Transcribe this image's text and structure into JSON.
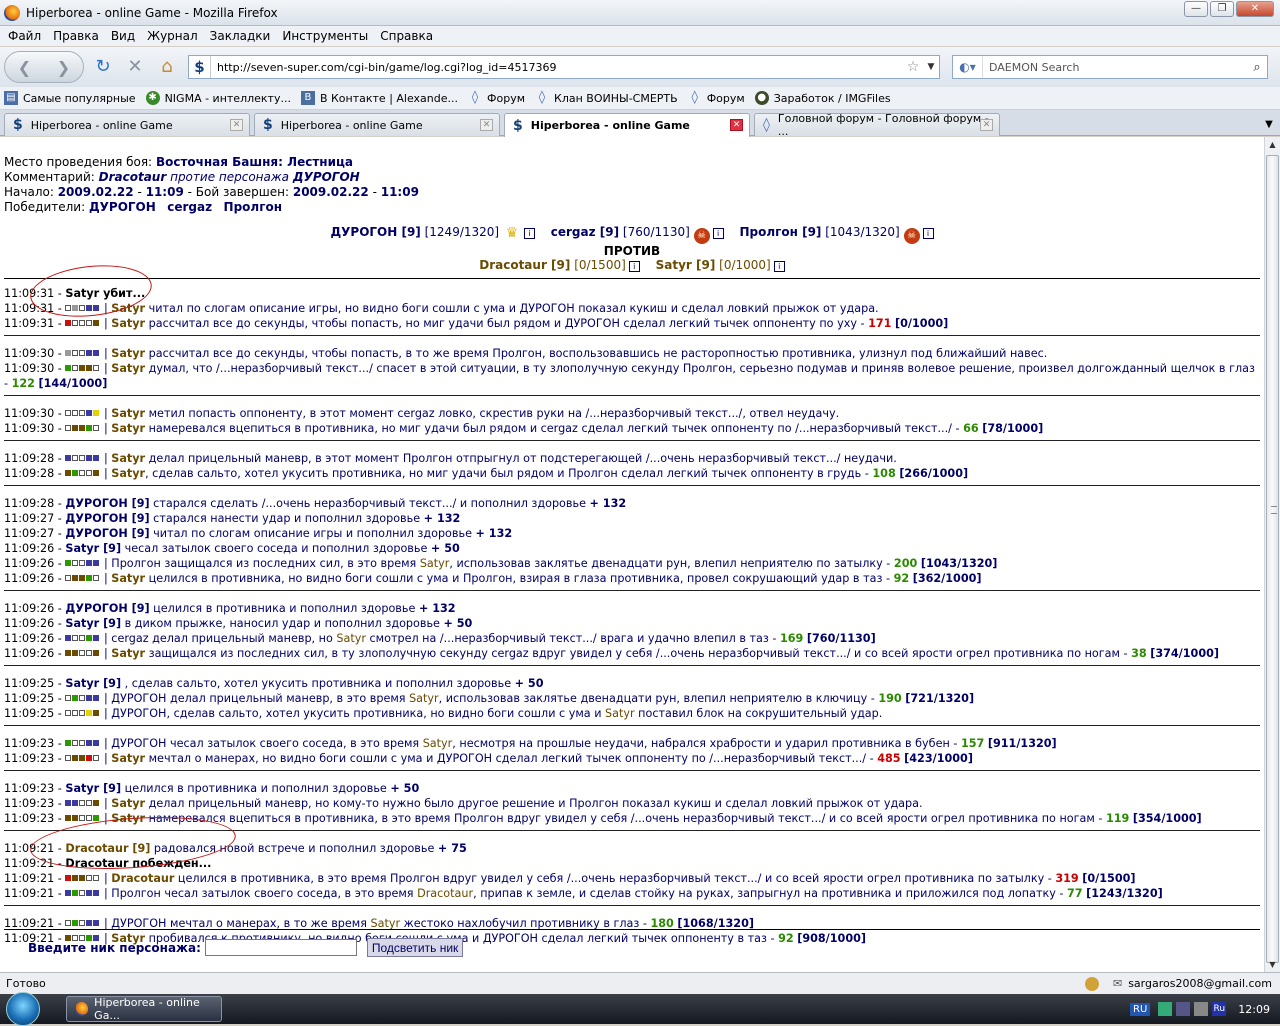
{
  "window": {
    "title": "Hiperborea - online Game - Mozilla Firefox"
  },
  "menu": [
    "Файл",
    "Правка",
    "Вид",
    "Журнал",
    "Закладки",
    "Инструменты",
    "Справка"
  ],
  "nav": {
    "url": "http://seven-super.com/cgi-bin/game/log.cgi?log_id=4517369",
    "search_placeholder": "DAEMON Search"
  },
  "bookmarks": [
    "Самые популярные",
    "NIGMA - интеллекту...",
    "В Контакте | Alexande...",
    "Форум",
    "Клан ВОИНЫ-СМЕРТЬ",
    "Форум",
    "Заработок / IMGFiles"
  ],
  "tabs": [
    {
      "label": "Hiperborea - online Game",
      "active": false
    },
    {
      "label": "Hiperborea - online Game",
      "active": false
    },
    {
      "label": "Hiperborea - online Game",
      "active": true
    },
    {
      "label": "Головной форум - Головной форум - ...",
      "active": false
    }
  ],
  "header": {
    "place_label": "Место проведения боя:",
    "place": "Восточная Башня: Лестница",
    "comment_label": "Комментарий:",
    "comment_a": "Dracotaur",
    "comment_mid": "протие персонажа",
    "comment_b": "ДУРОГОН",
    "start_label": "Начало:",
    "start_date": "2009.02.22",
    "start_time": "11:09",
    "end_label": "- Бой завершен:",
    "end_date": "2009.02.22",
    "end_time": "11:09",
    "winners_label": "Победители:",
    "winners": [
      "ДУРОГОН",
      "cergaz",
      "Пролгон"
    ]
  },
  "team1": [
    {
      "name": "ДУРОГОН [9]",
      "hp": "[1249/1320]",
      "badge": "crown"
    },
    {
      "name": "cergaz [9]",
      "hp": "[760/1130]",
      "badge": "skull"
    },
    {
      "name": "Пролгон [9]",
      "hp": "[1043/1320]",
      "badge": "skull"
    }
  ],
  "vs": "ПРОТИВ",
  "team2": [
    {
      "name": "Dracotaur [9]",
      "hp": "[0/1500]"
    },
    {
      "name": "Satyr [9]",
      "hp": "[0/1000]"
    }
  ],
  "form": {
    "label": "Введите ник персонажа:",
    "button": "Подсветить ник"
  },
  "status": {
    "text": "Готово",
    "email": "sargaros2008@gmail.com"
  },
  "taskbar": {
    "button": "Hiperborea - online Ga...",
    "lang": "RU",
    "time": "12:09"
  }
}
